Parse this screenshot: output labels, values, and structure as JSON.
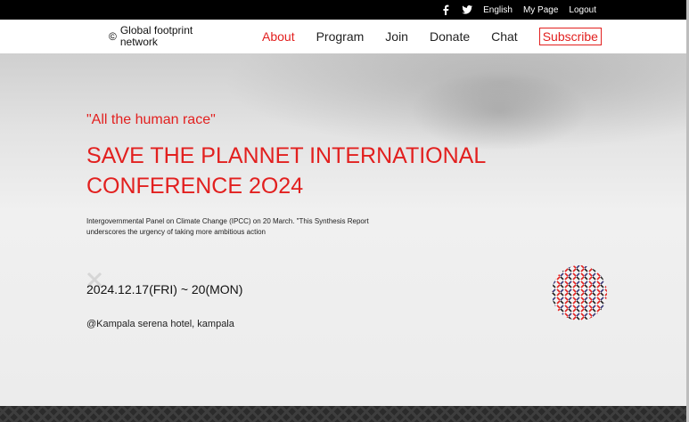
{
  "topbar": {
    "facebook_icon": "facebook-icon",
    "twitter_icon": "twitter-icon",
    "language": "English",
    "my_page": "My Page",
    "logout": "Logout"
  },
  "logo": {
    "mark": "©",
    "name": "Global footprint network"
  },
  "nav": {
    "about": "About",
    "program": "Program",
    "join": "Join",
    "donate": "Donate",
    "chat": "Chat",
    "subscribe": "Subscribe"
  },
  "hero": {
    "quote": "\"All the human race\"",
    "title": "SAVE THE PLANNET INTERNATIONAL CONFERENCE 2O24",
    "description": "Intergovernmental Panel on Climate Change (IPCC) on 20 March. \"This Synthesis Report underscores the urgency of taking more ambitious action",
    "date": "2024.12.17(FRI) ~ 20(MON)",
    "venue": "@Kampala serena hotel, kampala"
  },
  "colors": {
    "accent": "#e2201f",
    "topbar": "#000000",
    "footer": "#2b2b2b"
  }
}
